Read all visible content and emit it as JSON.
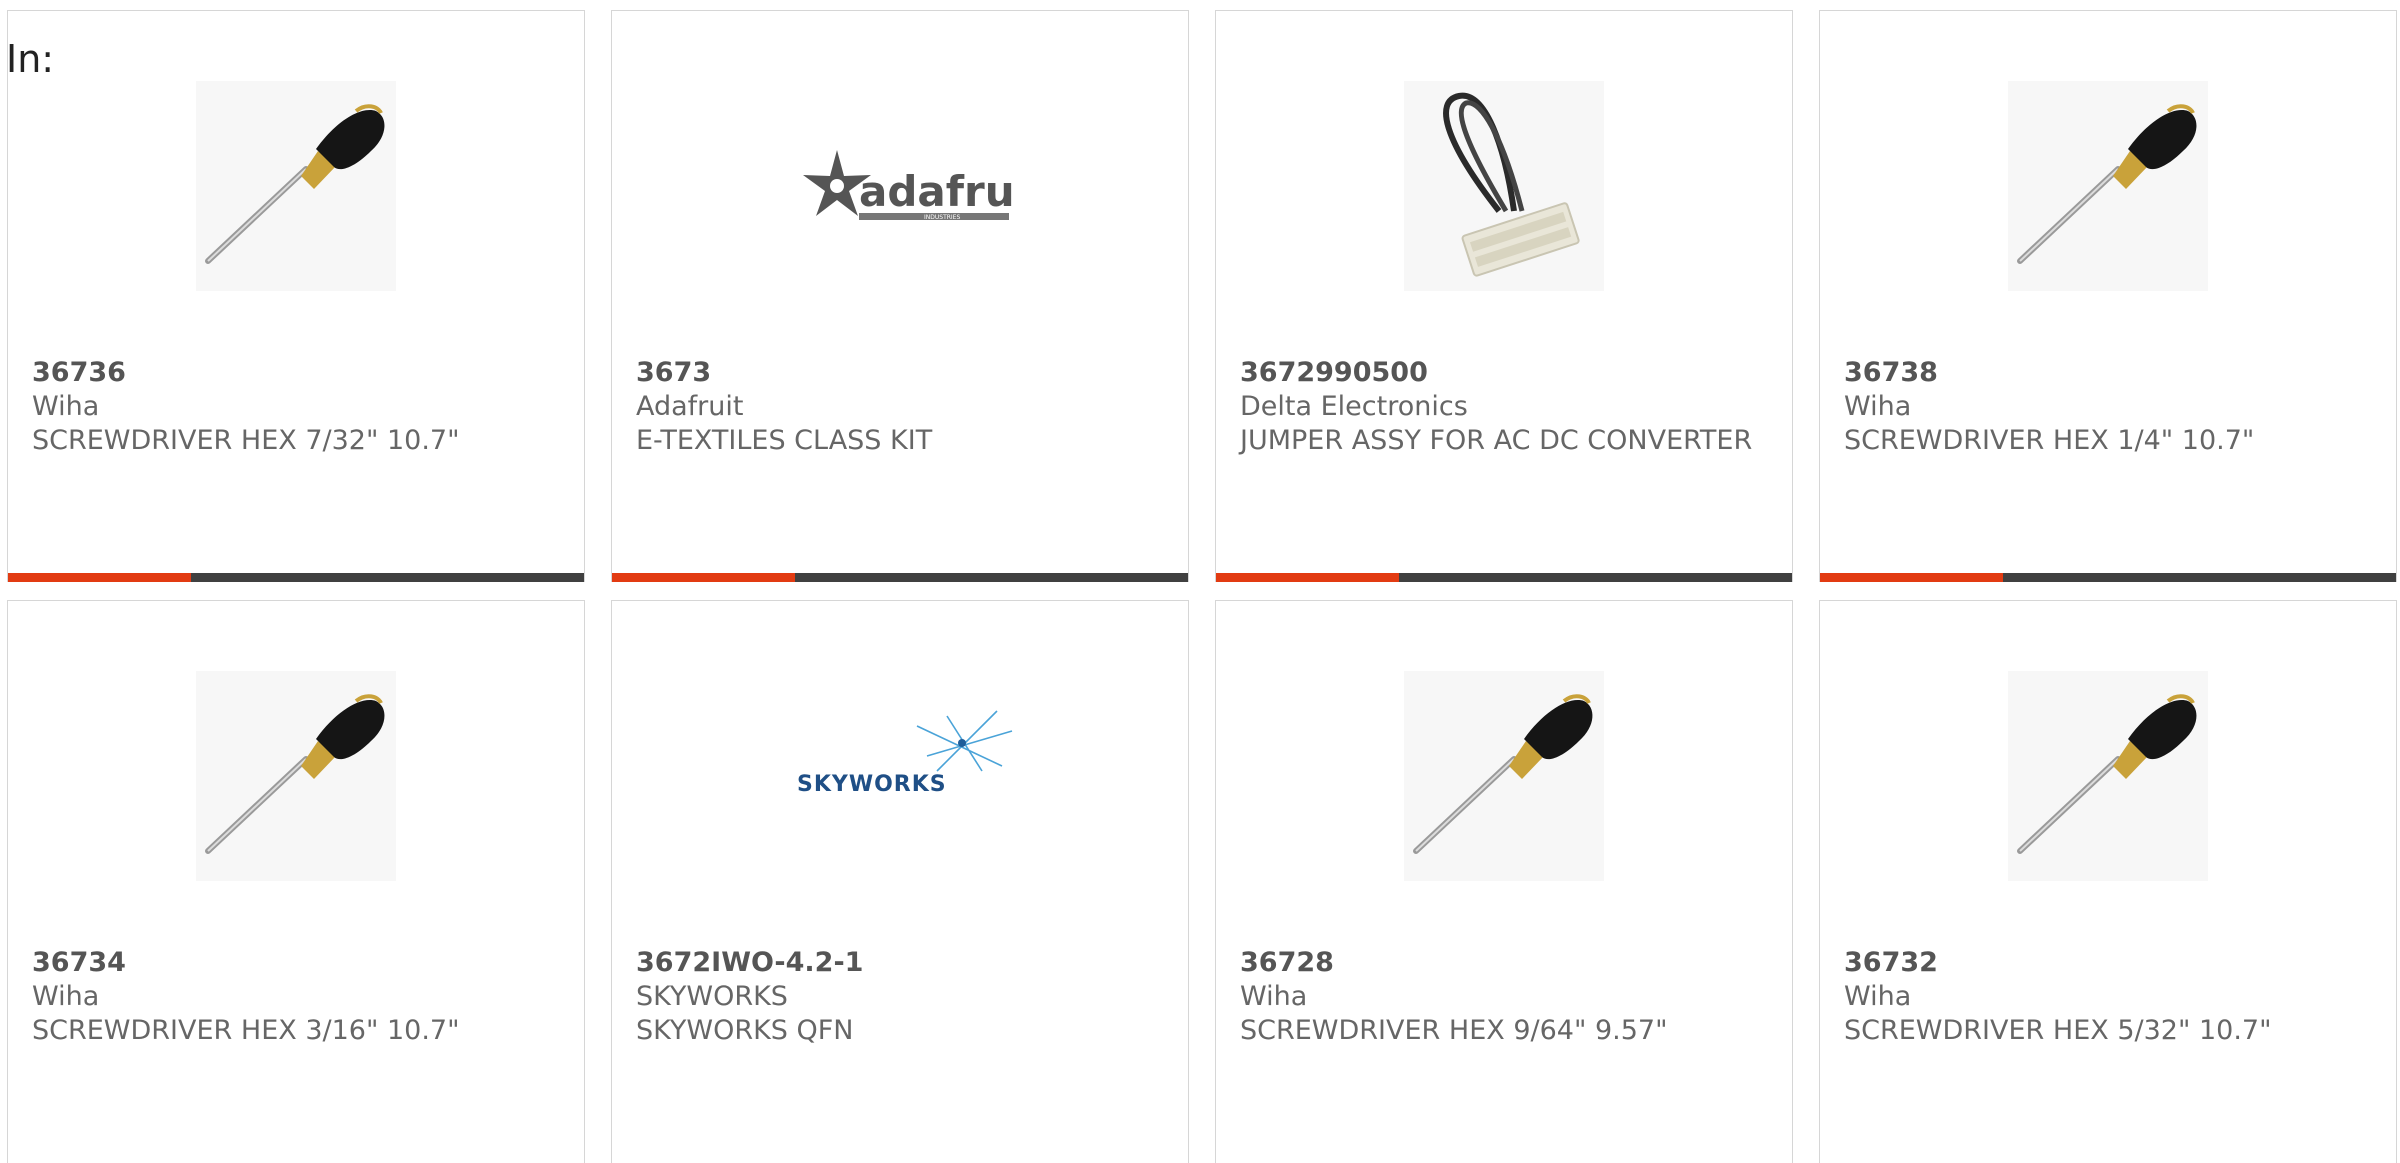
{
  "header": {
    "in_label": "In:"
  },
  "colors": {
    "accent": "#e23b12",
    "bar": "#404040",
    "text": "#666666"
  },
  "products": [
    {
      "part_number": "36736",
      "manufacturer": "Wiha",
      "description": "SCREWDRIVER HEX 7/32\" 10.7\"",
      "image": "screwdriver-image"
    },
    {
      "part_number": "3673",
      "manufacturer": "Adafruit",
      "description": "E-TEXTILES CLASS KIT",
      "image": "adafruit-logo",
      "logo_text": "adafruit",
      "logo_subtext": "INDUSTRIES"
    },
    {
      "part_number": "3672990500",
      "manufacturer": "Delta Electronics",
      "description": "JUMPER ASSY FOR AC DC CONVERTER",
      "image": "jumper-cable-image"
    },
    {
      "part_number": "36738",
      "manufacturer": "Wiha",
      "description": "SCREWDRIVER HEX 1/4\" 10.7\"",
      "image": "screwdriver-image"
    },
    {
      "part_number": "36734",
      "manufacturer": "Wiha",
      "description": "SCREWDRIVER HEX 3/16\" 10.7\"",
      "image": "screwdriver-image"
    },
    {
      "part_number": "3672IWO-4.2-1",
      "manufacturer": "SKYWORKS",
      "description": "SKYWORKS QFN",
      "image": "skyworks-logo",
      "logo_text": "SKYWORKS"
    },
    {
      "part_number": "36728",
      "manufacturer": "Wiha",
      "description": "SCREWDRIVER HEX 9/64\" 9.57\"",
      "image": "screwdriver-image"
    },
    {
      "part_number": "36732",
      "manufacturer": "Wiha",
      "description": "SCREWDRIVER HEX 5/32\" 10.7\"",
      "image": "screwdriver-image"
    }
  ]
}
